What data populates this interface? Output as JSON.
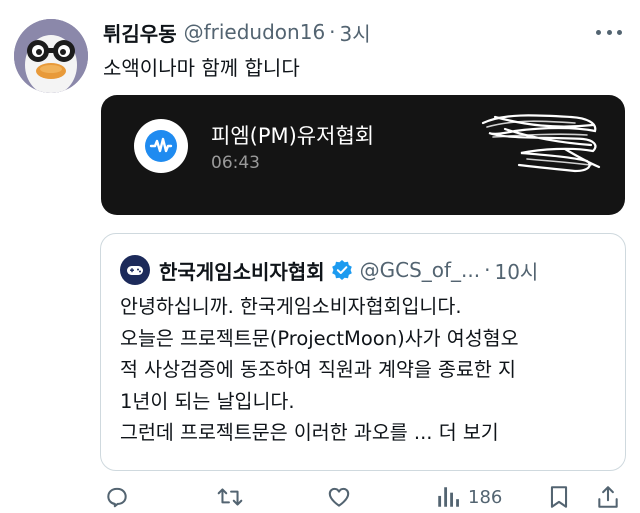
{
  "tweet": {
    "display_name": "튀김우동",
    "handle": "@friedudon16",
    "separator": "·",
    "time": "3시",
    "text": "소액이나마 함께 합니다"
  },
  "notification": {
    "title": "피엠(PM)유저협회",
    "time": "06:43",
    "icon": "waveform-icon",
    "accent_color": "#1f8bf0",
    "background": "#141414"
  },
  "quote": {
    "display_name": "한국게임소비자협회",
    "handle": "@GCS_of_...",
    "separator": "·",
    "time": "10시",
    "lines": [
      "안녕하십니까. 한국게임소비자협회입니다.",
      "오늘은 프로젝트문(ProjectMoon)사가 여성혐오",
      "적 사상검증에 동조하여 직원과 계약을 종료한 지",
      "1년이 되는 날입니다.",
      "그런데 프로젝트문은 이러한 과오를"
    ],
    "show_more": "... 더 보기"
  },
  "actions": {
    "reply_icon": "reply-icon",
    "retweet_icon": "retweet-icon",
    "like_icon": "heart-icon",
    "views_icon": "views-icon",
    "views_count": "186",
    "bookmark_icon": "bookmark-icon",
    "share_icon": "share-icon"
  },
  "colors": {
    "text_primary": "#0f1419",
    "text_secondary": "#536471",
    "verified": "#1d9bf0",
    "border": "#cfd9de"
  }
}
